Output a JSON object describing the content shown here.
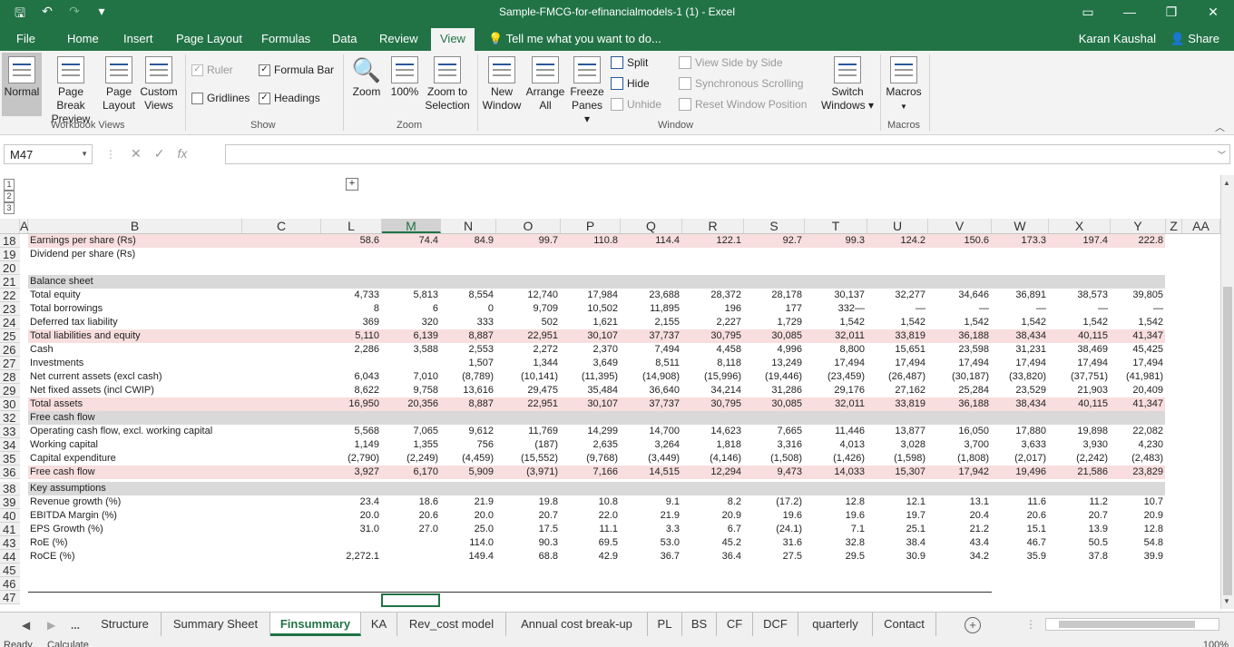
{
  "window": {
    "title": "Sample-FMCG-for-efinancialmodels-1 (1) - Excel",
    "user": "Karan Kaushal",
    "share_label": "Share",
    "tell_me": "Tell me what you want to do..."
  },
  "ribbon_tabs": [
    "File",
    "Home",
    "Insert",
    "Page Layout",
    "Formulas",
    "Data",
    "Review",
    "View"
  ],
  "active_tab": "View",
  "ribbon": {
    "workbook_views": {
      "label": "Workbook Views",
      "normal": "Normal",
      "page_break_1": "Page Break",
      "page_break_2": "Preview",
      "page_layout_1": "Page",
      "page_layout_2": "Layout",
      "custom_1": "Custom",
      "custom_2": "Views"
    },
    "show": {
      "label": "Show",
      "ruler": "Ruler",
      "formula_bar": "Formula Bar",
      "gridlines": "Gridlines",
      "headings": "Headings"
    },
    "zoom": {
      "label": "Zoom",
      "zoom": "Zoom",
      "hundred": "100%",
      "sel_1": "Zoom to",
      "sel_2": "Selection"
    },
    "window": {
      "label": "Window",
      "new_1": "New",
      "new_2": "Window",
      "arrange_1": "Arrange",
      "arrange_2": "All",
      "freeze_1": "Freeze",
      "freeze_2": "Panes ▾",
      "split": "Split",
      "hide": "Hide",
      "unhide": "Unhide",
      "side": "View Side by Side",
      "sync": "Synchronous Scrolling",
      "reset": "Reset Window Position",
      "switch_1": "Switch",
      "switch_2": "Windows ▾"
    },
    "macros": {
      "label": "Macros",
      "macros": "Macros"
    }
  },
  "formula_bar": {
    "name_box": "M47",
    "formula": "",
    "fx": "fx"
  },
  "outline_levels": [
    "1",
    "2",
    "3"
  ],
  "columns": [
    "A",
    "B",
    "C",
    "L",
    "M",
    "N",
    "O",
    "P",
    "Q",
    "R",
    "S",
    "T",
    "U",
    "V",
    "W",
    "X",
    "Y",
    "Z",
    "AA"
  ],
  "selected_column": "M",
  "rows": [
    {
      "n": "18",
      "label": "Earnings per share (Rs)",
      "style": "pink",
      "values": [
        "58.6",
        "74.4",
        "84.9",
        "99.7",
        "110.8",
        "114.4",
        "122.1",
        "92.7",
        "99.3",
        "124.2",
        "150.6",
        "173.3",
        "197.4",
        "222.8"
      ]
    },
    {
      "n": "19",
      "label": "Dividend per share (Rs)",
      "style": "",
      "values": [
        "",
        "",
        "",
        "",
        "",
        "",
        "",
        "",
        "",
        "",
        "",
        "",
        "",
        ""
      ]
    },
    {
      "n": "20",
      "label": "",
      "style": "",
      "values": [
        "",
        "",
        "",
        "",
        "",
        "",
        "",
        "",
        "",
        "",
        "",
        "",
        "",
        ""
      ]
    },
    {
      "n": "21",
      "label": "Balance sheet",
      "style": "gray",
      "values": [
        "",
        "",
        "",
        "",
        "",
        "",
        "",
        "",
        "",
        "",
        "",
        "",
        "",
        ""
      ]
    },
    {
      "n": "22",
      "label": "Total equity",
      "style": "",
      "values": [
        "4,733",
        "5,813",
        "8,554",
        "12,740",
        "17,984",
        "23,688",
        "28,372",
        "28,178",
        "30,137",
        "32,277",
        "34,646",
        "36,891",
        "38,573",
        "39,805"
      ]
    },
    {
      "n": "23",
      "label": "Total borrowings",
      "style": "",
      "values": [
        "8",
        "6",
        "0",
        "9,709",
        "10,502",
        "11,895",
        "196",
        "177",
        "332—",
        "—",
        "—",
        "—",
        "—",
        "—"
      ]
    },
    {
      "n": "24",
      "label": "Deferred tax liability",
      "style": "",
      "values": [
        "369",
        "320",
        "333",
        "502",
        "1,621",
        "2,155",
        "2,227",
        "1,729",
        "1,542",
        "1,542",
        "1,542",
        "1,542",
        "1,542",
        "1,542"
      ]
    },
    {
      "n": "25",
      "label": "Total liabilities and equity",
      "style": "pink",
      "values": [
        "5,110",
        "6,139",
        "8,887",
        "22,951",
        "30,107",
        "37,737",
        "30,795",
        "30,085",
        "32,011",
        "33,819",
        "36,188",
        "38,434",
        "40,115",
        "41,347"
      ]
    },
    {
      "n": "26",
      "label": "Cash",
      "style": "",
      "values": [
        "2,286",
        "3,588",
        "2,553",
        "2,272",
        "2,370",
        "7,494",
        "4,458",
        "4,996",
        "8,800",
        "15,651",
        "23,598",
        "31,231",
        "38,469",
        "45,425"
      ]
    },
    {
      "n": "27",
      "label": "Investments",
      "style": "",
      "values": [
        "",
        "",
        "1,507",
        "1,344",
        "3,649",
        "8,511",
        "8,118",
        "13,249",
        "17,494",
        "17,494",
        "17,494",
        "17,494",
        "17,494",
        "17,494"
      ]
    },
    {
      "n": "28",
      "label": "Net current assets (excl cash)",
      "style": "",
      "values": [
        "6,043",
        "7,010",
        "(8,789)",
        "(10,141)",
        "(11,395)",
        "(14,908)",
        "(15,996)",
        "(19,446)",
        "(23,459)",
        "(26,487)",
        "(30,187)",
        "(33,820)",
        "(37,751)",
        "(41,981)"
      ]
    },
    {
      "n": "29",
      "label": "Net fixed assets (incl CWIP)",
      "style": "",
      "values": [
        "8,622",
        "9,758",
        "13,616",
        "29,475",
        "35,484",
        "36,640",
        "34,214",
        "31,286",
        "29,176",
        "27,162",
        "25,284",
        "23,529",
        "21,903",
        "20,409"
      ]
    },
    {
      "n": "30",
      "label": "Total assets",
      "style": "pink",
      "values": [
        "16,950",
        "20,356",
        "8,887",
        "22,951",
        "30,107",
        "37,737",
        "30,795",
        "30,085",
        "32,011",
        "33,819",
        "36,188",
        "38,434",
        "40,115",
        "41,347"
      ]
    },
    {
      "n": "32",
      "label": "Free cash flow",
      "style": "gray",
      "values": [
        "",
        "",
        "",
        "",
        "",
        "",
        "",
        "",
        "",
        "",
        "",
        "",
        "",
        ""
      ]
    },
    {
      "n": "33",
      "label": "Operating cash flow, excl. working capital",
      "style": "",
      "values": [
        "5,568",
        "7,065",
        "9,612",
        "11,769",
        "14,299",
        "14,700",
        "14,623",
        "7,665",
        "11,446",
        "13,877",
        "16,050",
        "17,880",
        "19,898",
        "22,082"
      ]
    },
    {
      "n": "34",
      "label": "Working capital",
      "style": "",
      "values": [
        "1,149",
        "1,355",
        "756",
        "(187)",
        "2,635",
        "3,264",
        "1,818",
        "3,316",
        "4,013",
        "3,028",
        "3,700",
        "3,633",
        "3,930",
        "4,230"
      ]
    },
    {
      "n": "35",
      "label": "Capital expenditure",
      "style": "",
      "values": [
        "(2,790)",
        "(2,249)",
        "(4,459)",
        "(15,552)",
        "(9,768)",
        "(3,449)",
        "(4,146)",
        "(1,508)",
        "(1,426)",
        "(1,598)",
        "(1,808)",
        "(2,017)",
        "(2,242)",
        "(2,483)"
      ]
    },
    {
      "n": "36",
      "label": "Free cash flow",
      "style": "pink",
      "values": [
        "3,927",
        "6,170",
        "5,909",
        "(3,971)",
        "7,166",
        "14,515",
        "12,294",
        "9,473",
        "14,033",
        "15,307",
        "17,942",
        "19,496",
        "21,586",
        "23,829"
      ]
    },
    {
      "n": "38",
      "label": "Key assumptions",
      "style": "gray",
      "values": [
        "",
        "",
        "",
        "",
        "",
        "",
        "",
        "",
        "",
        "",
        "",
        "",
        "",
        ""
      ]
    },
    {
      "n": "39",
      "label": "Revenue growth (%)",
      "style": "",
      "values": [
        "23.4",
        "18.6",
        "21.9",
        "19.8",
        "10.8",
        "9.1",
        "8.2",
        "(17.2)",
        "12.8",
        "12.1",
        "13.1",
        "11.6",
        "11.2",
        "10.7"
      ]
    },
    {
      "n": "40",
      "label": "EBITDA Margin (%)",
      "style": "",
      "values": [
        "20.0",
        "20.6",
        "20.0",
        "20.7",
        "22.0",
        "21.9",
        "20.9",
        "19.6",
        "19.6",
        "19.7",
        "20.4",
        "20.6",
        "20.7",
        "20.9"
      ]
    },
    {
      "n": "41",
      "label": "EPS Growth (%)",
      "style": "",
      "values": [
        "31.0",
        "27.0",
        "25.0",
        "17.5",
        "11.1",
        "3.3",
        "6.7",
        "(24.1)",
        "7.1",
        "25.1",
        "21.2",
        "15.1",
        "13.9",
        "12.8"
      ]
    },
    {
      "n": "43",
      "label": "RoE (%)",
      "style": "",
      "values": [
        "",
        "",
        "114.0",
        "90.3",
        "69.5",
        "53.0",
        "45.2",
        "31.6",
        "32.8",
        "38.4",
        "43.4",
        "46.7",
        "50.5",
        "54.8"
      ]
    },
    {
      "n": "44",
      "label": "RoCE (%)",
      "style": "",
      "values": [
        "2,272.1",
        "",
        "149.4",
        "68.8",
        "42.9",
        "36.7",
        "36.4",
        "27.5",
        "29.5",
        "30.9",
        "34.2",
        "35.9",
        "37.8",
        "39.9"
      ]
    },
    {
      "n": "45",
      "label": "",
      "style": "",
      "values": [
        "",
        "",
        "",
        "",
        "",
        "",
        "",
        "",
        "",
        "",
        "",
        "",
        "",
        ""
      ]
    },
    {
      "n": "46",
      "label": "",
      "style": "",
      "values": [
        "",
        "",
        "",
        "",
        "",
        "",
        "",
        "",
        "",
        "",
        "",
        "",
        "",
        ""
      ]
    },
    {
      "n": "47",
      "label": "",
      "style": "",
      "values": [
        "",
        "",
        "",
        "",
        "",
        "",
        "",
        "",
        "",
        "",
        "",
        "",
        "",
        ""
      ]
    }
  ],
  "sheet_tabs": [
    "Structure",
    "Summary Sheet",
    "Finsummary",
    "KA",
    "Rev_cost model",
    "Annual cost break-up",
    "PL",
    "BS",
    "CF",
    "DCF",
    "quarterly",
    "Contact"
  ],
  "active_sheet": "Finsummary",
  "sheet_nav_more": "...",
  "status": {
    "ready": "Ready",
    "calculate": "Calculate",
    "zoom": "100%"
  }
}
